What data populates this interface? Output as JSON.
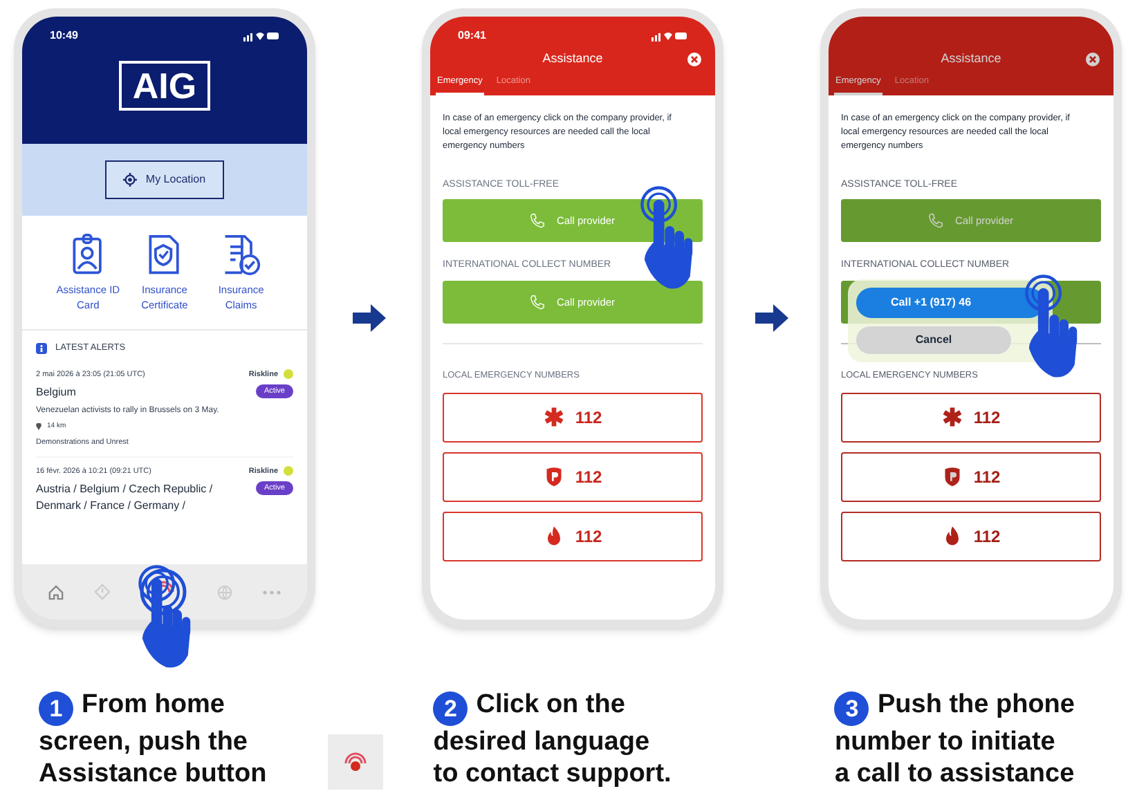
{
  "steps": [
    {
      "number": "1",
      "caption_lines": [
        "From home",
        "screen, push the",
        "Assistance button"
      ],
      "thumbnail": true,
      "screen": {
        "kind": "home",
        "time": "10:49",
        "logo": "AIG",
        "location_button": "My Location",
        "shortcuts": [
          {
            "kind": "id_card",
            "label": "Assistance ID Card"
          },
          {
            "kind": "certificate",
            "label": "Insurance Certificate"
          },
          {
            "kind": "claims",
            "label": "Insurance Claims"
          }
        ],
        "alerts_title": "LATEST ALERTS",
        "alerts": [
          {
            "date": "2 mai 2026 à 23:05 (21:05 UTC)",
            "source": "Riskline",
            "color": "#d4e03a",
            "status": "Active",
            "title": "Belgium",
            "description": "Venezuelan activists to rally in Brussels on 3 May.",
            "distance": "14 km",
            "category": "Demonstrations and Unrest"
          },
          {
            "date": "16 févr. 2026 à 10:21 (09:21 UTC)",
            "source": "Riskline",
            "color": "#d4e03a",
            "status": "Active",
            "title": "Austria / Belgium / Czech Republic / Denmark / France / Germany /"
          }
        ]
      }
    },
    {
      "number": "2",
      "caption_lines": [
        "Click on the",
        "desired language",
        "to contact support."
      ],
      "thumbnail": false,
      "screen": {
        "kind": "assistance",
        "time": "09:41",
        "dimmed": false,
        "title": "Assistance",
        "tabs": [
          {
            "label": "Emergency",
            "selected": true
          },
          {
            "label": "Location",
            "selected": false
          }
        ],
        "intro": "In case of an emergency click on the company provider, if local emergency resources are needed call the local emergency numbers",
        "providers": [
          {
            "label": "ASSISTANCE TOLL-FREE",
            "button": "Call provider"
          },
          {
            "label": "INTERNATIONAL COLLECT NUMBER",
            "button": "Call provider"
          }
        ],
        "local_title": "LOCAL EMERGENCY NUMBERS",
        "numbers": [
          {
            "kind": "medical",
            "number": "112"
          },
          {
            "kind": "police",
            "number": "112"
          },
          {
            "kind": "fire",
            "number": "112"
          }
        ]
      }
    },
    {
      "number": "3",
      "caption_lines": [
        "Push the phone",
        "number to initiate",
        "a call to assistance"
      ],
      "thumbnail": false,
      "screen": {
        "kind": "assistance",
        "dimmed": true,
        "title": "Assistance",
        "tabs": [
          {
            "label": "Emergency",
            "selected": true
          },
          {
            "label": "Location",
            "selected": false
          }
        ],
        "intro": "In case of an emergency click on the company provider, if local emergency resources are needed call the local emergency numbers",
        "providers": [
          {
            "label": "ASSISTANCE TOLL-FREE",
            "button": "Call provider"
          },
          {
            "label": "INTERNATIONAL COLLECT NUMBER"
          }
        ],
        "local_title": "LOCAL EMERGENCY NUMBERS",
        "numbers": [
          {
            "kind": "medical",
            "number": "112"
          },
          {
            "kind": "police",
            "number": "112"
          },
          {
            "kind": "fire",
            "number": "112"
          }
        ],
        "popup": {
          "call": "Call +1 (917) 46",
          "cancel": "Cancel"
        }
      }
    }
  ]
}
